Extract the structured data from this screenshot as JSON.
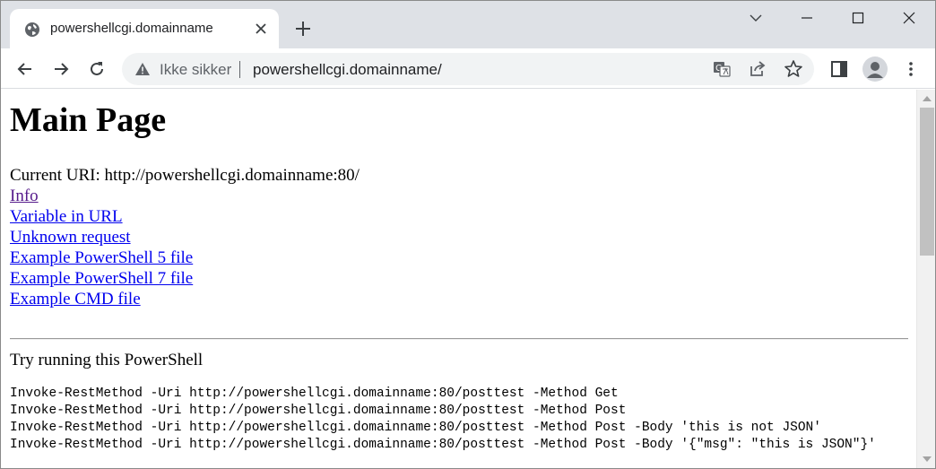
{
  "tab": {
    "title": "powershellcgi.domainname",
    "favicon": "globe-icon"
  },
  "omnibox": {
    "security_label": "Ikke sikker",
    "url": "powershellcgi.domainname/"
  },
  "page": {
    "title": "Main Page",
    "current_uri": "Current URI: http://powershellcgi.domainname:80/",
    "links": [
      {
        "label": "Info",
        "visited": true
      },
      {
        "label": "Variable in URL",
        "visited": false
      },
      {
        "label": "Unknown request",
        "visited": false
      },
      {
        "label": "Example PowerShell 5 file",
        "visited": false
      },
      {
        "label": "Example PowerShell 7 file",
        "visited": false
      },
      {
        "label": "Example CMD file",
        "visited": false
      }
    ],
    "try_text": "Try running this PowerShell",
    "code_lines": [
      "Invoke-RestMethod -Uri http://powershellcgi.domainname:80/posttest -Method Get",
      "Invoke-RestMethod -Uri http://powershellcgi.domainname:80/posttest -Method Post",
      "Invoke-RestMethod -Uri http://powershellcgi.domainname:80/posttest -Method Post -Body 'this is not JSON'",
      "Invoke-RestMethod -Uri http://powershellcgi.domainname:80/posttest -Method Post -Body '{\"msg\": \"this is JSON\"}'"
    ]
  },
  "colors": {
    "link": "#0000ee",
    "visited_link": "#551a8b",
    "tab_strip": "#dee1e6",
    "omnibox": "#f1f3f4"
  }
}
